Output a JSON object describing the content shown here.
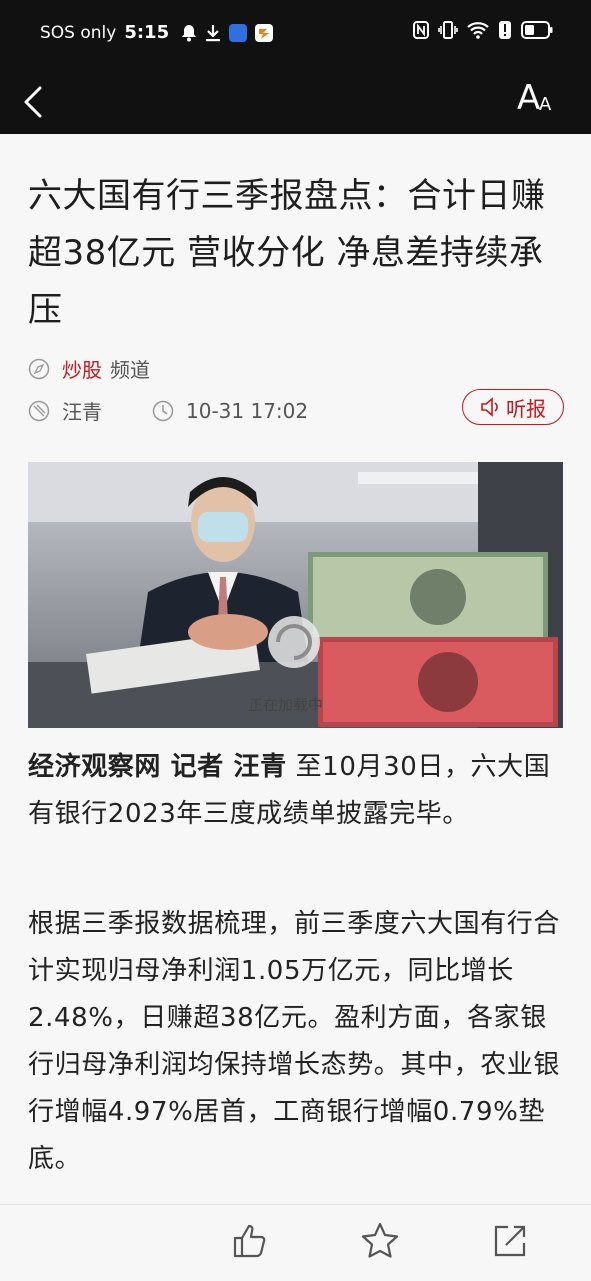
{
  "status_bar": {
    "carrier": "SOS only",
    "time": "5:15",
    "left_icons": [
      "bell-icon",
      "download-icon",
      "app-icon-blue",
      "app-icon-orange"
    ],
    "right_icons": [
      "nfc-icon",
      "vibrate-icon",
      "wifi-icon",
      "alert-icon",
      "battery-icon"
    ]
  },
  "nav": {
    "back_icon": "chevron-left-icon",
    "font_size_icon": "font-size-icon",
    "font_big": "A",
    "font_small": "A"
  },
  "article": {
    "title": "六大国有行三季报盘点：合计日赚超38亿元 营收分化 净息差持续承压",
    "channel_name": "炒股",
    "channel_suffix": "频道",
    "author": "汪青",
    "datetime": "10-31 17:02",
    "listen_label": "听报",
    "image_loading_text": "正在加载中",
    "lead_bold": "经济观察网 记者 汪青",
    "lead_text": " 至10月30日，六大国有银行2023年三度成绩单披露完毕。",
    "body_paragraph": "根据三季报数据梳理，前三季度六大国有行合计实现归母净利润1.05万亿元，同比增长2.48%，日赚超38亿元。盈利方面，各家银行归母净利润均保持增长态势。其中，农业银行增幅4.97%居首，工商银行增幅0.79%垫底。"
  },
  "bottom_bar": {
    "icons": [
      "thumbs-up-icon",
      "star-icon",
      "share-icon"
    ]
  },
  "colors": {
    "accent": "#c8161d",
    "header_bg": "#111111",
    "page_bg": "#f7f7f7"
  }
}
